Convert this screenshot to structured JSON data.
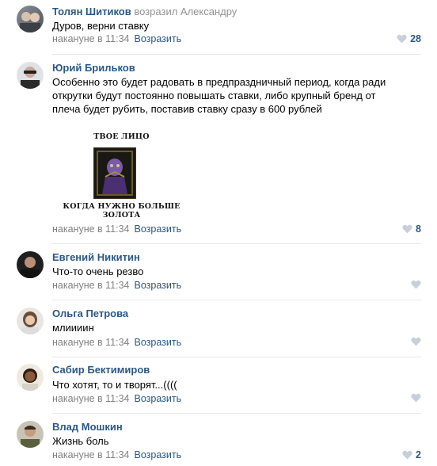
{
  "comments": [
    {
      "author": "Толян Шитиков",
      "reply_to": "возразил Александру",
      "text": "Дуров, верни ставку",
      "time": "накануне в 11:34",
      "reply_label": "Возразить",
      "likes": "28"
    },
    {
      "author": "Юрий Брильков",
      "text": "Особенно это будет радовать в предпраздничный период, когда ради открутки будут постоянно повышать ставки, либо крупный бренд от плеча будет рубить, поставив ставку сразу в 600 рублей",
      "image": {
        "top_caption": "ТВОЕ ЛИЦО",
        "bottom_caption": "КОГДА НУЖНО БОЛЬШЕ ЗОЛОТА"
      },
      "time": "накануне в 11:34",
      "reply_label": "Возразить",
      "likes": "8"
    },
    {
      "author": "Евгений Никитин",
      "text": "Что-то очень резво",
      "time": "накануне в 11:34",
      "reply_label": "Возразить",
      "likes": ""
    },
    {
      "author": "Ольга Петрова",
      "text": "млиииин",
      "time": "накануне в 11:34",
      "reply_label": "Возразить",
      "likes": ""
    },
    {
      "author": "Сабир Бектимиров",
      "text": "Что хотят, то и творят...((((",
      "time": "накануне в 11:34",
      "reply_label": "Возразить",
      "likes": ""
    },
    {
      "author": "Влад Мошкин",
      "text": "Жизнь боль",
      "time": "накануне в 11:34",
      "reply_label": "Возразить",
      "likes": "2"
    }
  ],
  "colors": {
    "link": "#2a5885",
    "meta": "#828282",
    "like_inactive": "#c5d0db",
    "divider": "#e7e8ec"
  }
}
